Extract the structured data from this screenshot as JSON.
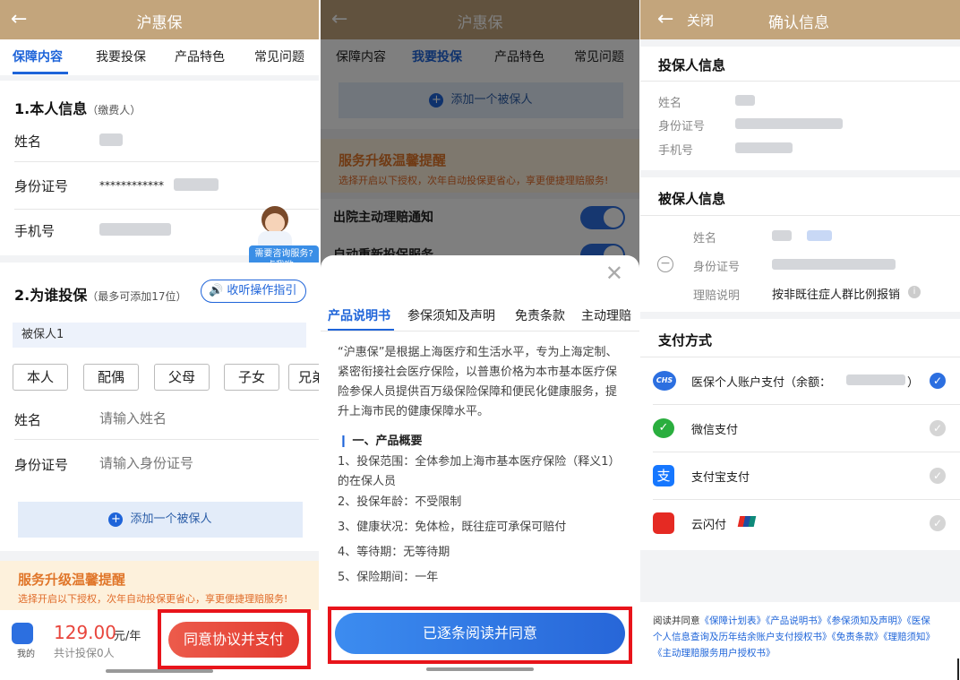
{
  "p1": {
    "header": {
      "back": "←",
      "title": "沪惠保"
    },
    "tabs": [
      "保障内容",
      "我要投保",
      "产品特色",
      "常见问题"
    ],
    "sec1_title": "1.本人信息",
    "sec1_sub": "（缴费人）",
    "name_label": "姓名",
    "id_label": "身份证号",
    "id_value": "************",
    "phone_label": "手机号",
    "cs_line1": "需要咨询服务?",
    "cs_line2": "点我哟~",
    "sec2_title": "2.为谁投保",
    "sec2_sub": "（最多可添加17位）",
    "guide_btn": "收听操作指引",
    "insured_label": "被保人1",
    "relations": [
      "本人",
      "配偶",
      "父母",
      "子女",
      "兄弟"
    ],
    "name_ph": "请输入姓名",
    "id_ph": "请输入身份证号",
    "add_insured": "添加一个被保人",
    "promo_title": "服务升级温馨提醒",
    "promo_text": "选择开启以下授权，次年自动投保更省心，享更便捷理赔服务!",
    "mine_label": "我的",
    "price": "129.00",
    "price_unit": "元/年",
    "total_label": "共计投保0人",
    "pay_btn": "同意协议并支付"
  },
  "p2": {
    "header": {
      "back": "←",
      "title": "沪惠保"
    },
    "tabs": [
      "保障内容",
      "我要投保",
      "产品特色",
      "常见问题"
    ],
    "add_insured": "添加一个被保人",
    "promo_title": "服务升级温馨提醒",
    "promo_text": "选择开启以下授权，次年自动投保更省心，享更便捷理赔服务!",
    "toggle1": "出院主动理赔通知",
    "toggle2": "自动重新投保服务",
    "sheet_tabs": [
      "产品说明书",
      "参保须知及声明",
      "免责条款",
      "主动理赔"
    ],
    "intro": "“沪惠保”是根据上海医疗和生活水平，专为上海定制、紧密衔接社会医疗保险，以普惠价格为本市基本医疗保险参保人员提供百万级保险保障和便民化健康服务，提升上海市民的健康保障水平。",
    "overview_title": "一、产品概要",
    "items": [
      "1、投保范围：全体参加上海市基本医疗保险（释义1）的在保人员",
      "2、投保年龄：不受限制",
      "3、健康状况：免体检，既往症可承保可赔付",
      "4、等待期：无等待期",
      "5、保险期间：一年"
    ],
    "agree_btn": "已逐条阅读并同意"
  },
  "p3": {
    "header": {
      "back": "←",
      "close": "关闭",
      "title": "确认信息"
    },
    "holder_title": "投保人信息",
    "holder_fields": [
      "姓名",
      "身份证号",
      "手机号"
    ],
    "insured_title": "被保人信息",
    "insured_fields": [
      "姓名",
      "身份证号",
      "理赔说明"
    ],
    "claim_value": "按非既往症人群比例报销",
    "pay_title": "支付方式",
    "methods": [
      "医保个人账户支付（余额：",
      "微信支付",
      "支付宝支付",
      "云闪付"
    ],
    "method_close": "）",
    "agreement": "阅读并同意《保障计划表》《产品说明书》《参保须知及声明》《医保个人信息查询及历年结余账户支付授权书》《免责条款》《理赔须知》《主动理赔服务用户授权书》",
    "agreement_prefix": "阅读并同意"
  },
  "colors": {
    "header": "#c3a57c",
    "accent": "#1e64d9",
    "pay_red": "#e8453c",
    "promo_orange": "#e0762a",
    "highlight": "#e8141b"
  }
}
